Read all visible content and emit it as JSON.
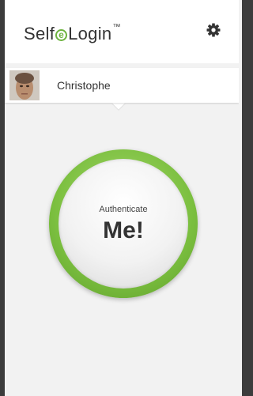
{
  "header": {
    "logo_part1": "Self",
    "logo_mark": "e",
    "logo_part2": "Login",
    "logo_tm": "™",
    "settings_icon": "gear-icon"
  },
  "user": {
    "name": "Christophe",
    "avatar": "avatar"
  },
  "auth": {
    "subtitle": "Authenticate",
    "title": "Me!"
  },
  "colors": {
    "accent": "#6db33f",
    "ring": "#7bbf3f",
    "background": "#f2f2f2"
  }
}
